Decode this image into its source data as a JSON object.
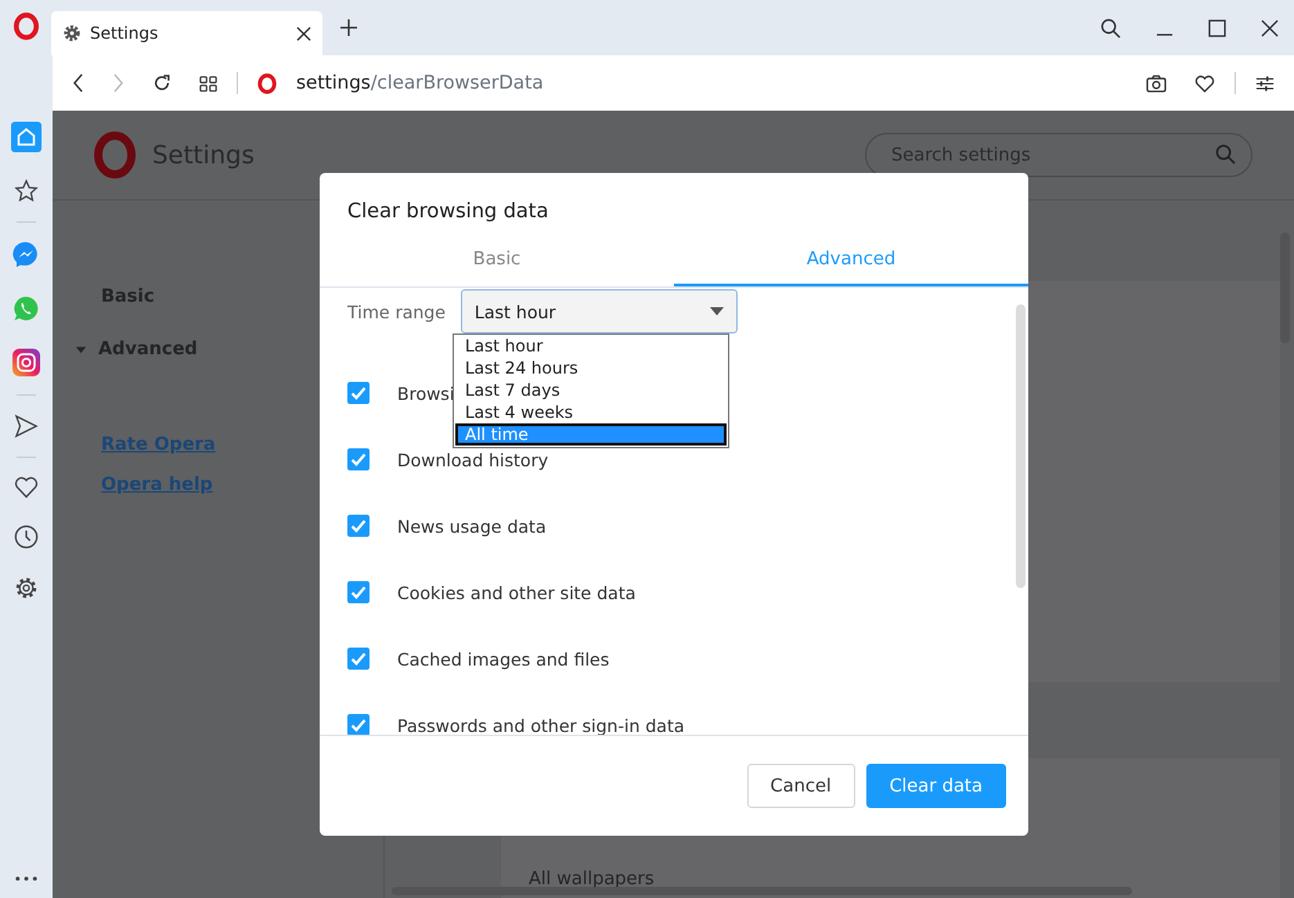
{
  "browser": {
    "tab": {
      "title": "Settings"
    },
    "address": {
      "host": "settings",
      "path": "/clearBrowserData"
    }
  },
  "page": {
    "title": "Settings",
    "search": {
      "placeholder": "Search settings"
    },
    "nav": [
      {
        "label": "Basic",
        "kind": "plain"
      },
      {
        "label": "Advanced",
        "kind": "group",
        "expanded": true
      }
    ],
    "links": [
      "Rate Opera",
      "Opera help"
    ],
    "content_text": "All wallpapers"
  },
  "dialog": {
    "title": "Clear browsing data",
    "tabs": [
      {
        "label": "Basic",
        "selected": false
      },
      {
        "label": "Advanced",
        "selected": true
      }
    ],
    "time_range": {
      "label": "Time range",
      "value": "Last hour",
      "expanded": true,
      "options": [
        {
          "label": "Last hour",
          "highlighted": false
        },
        {
          "label": "Last 24 hours",
          "highlighted": false
        },
        {
          "label": "Last 7 days",
          "highlighted": false
        },
        {
          "label": "Last 4 weeks",
          "highlighted": false
        },
        {
          "label": "All time",
          "highlighted": true
        }
      ]
    },
    "items": [
      {
        "label": "Browsi",
        "checked": true
      },
      {
        "label": "Download history",
        "checked": true
      },
      {
        "label": "News usage data",
        "checked": true
      },
      {
        "label": "Cookies and other site data",
        "checked": true
      },
      {
        "label": "Cached images and files",
        "checked": true
      },
      {
        "label": "Passwords and other sign-in data",
        "checked": true
      }
    ],
    "buttons": [
      {
        "label": "Cancel",
        "kind": "secondary"
      },
      {
        "label": "Clear data",
        "kind": "primary"
      }
    ]
  }
}
